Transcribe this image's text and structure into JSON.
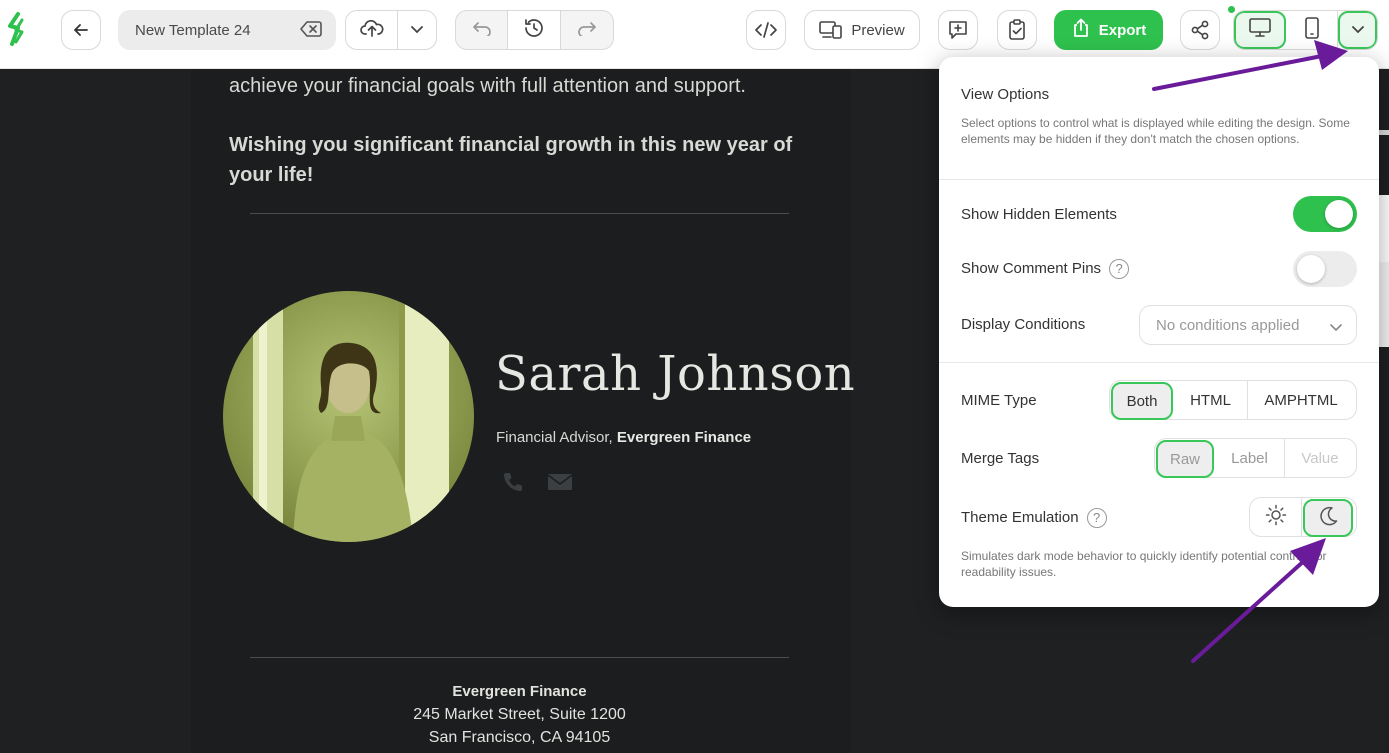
{
  "toolbar": {
    "template_name": "New Template 24",
    "preview_label": "Preview",
    "export_label": "Export"
  },
  "email": {
    "paragraph1": "achieve your financial goals with full attention and support.",
    "paragraph2": "Wishing you significant financial growth in this new year of your life!",
    "signature_name": "Sarah Johnson",
    "role_prefix": "Financial Advisor, ",
    "company": "Evergreen Finance",
    "footer_company": "Evergreen Finance",
    "footer_address1": "245 Market Street, Suite 1200",
    "footer_address2": "San Francisco, CA 94105"
  },
  "view_options": {
    "title": "View Options",
    "description": "Select options to control what is displayed while editing the design. Some elements may be hidden if they don't match the chosen options.",
    "show_hidden_label": "Show Hidden Elements",
    "show_hidden_on": true,
    "show_comment_pins_label": "Show Comment Pins",
    "show_comment_pins_on": false,
    "display_conditions_label": "Display Conditions",
    "display_conditions_value": "No conditions applied",
    "mime_type_label": "MIME Type",
    "mime_options": [
      "Both",
      "HTML",
      "AMPHTML"
    ],
    "mime_selected": "Both",
    "merge_tags_label": "Merge Tags",
    "merge_options": [
      "Raw",
      "Label",
      "Value"
    ],
    "merge_selected": "Raw",
    "theme_label": "Theme Emulation",
    "theme_selected": "dark",
    "theme_note": "Simulates dark mode behavior to quickly identify potential contrast or readability issues.",
    "help_glyph": "?"
  },
  "colors": {
    "accent_green": "#2fc14e",
    "annotation_arrow": "#6a1b9a",
    "email_bg": "#1b1d1f"
  }
}
